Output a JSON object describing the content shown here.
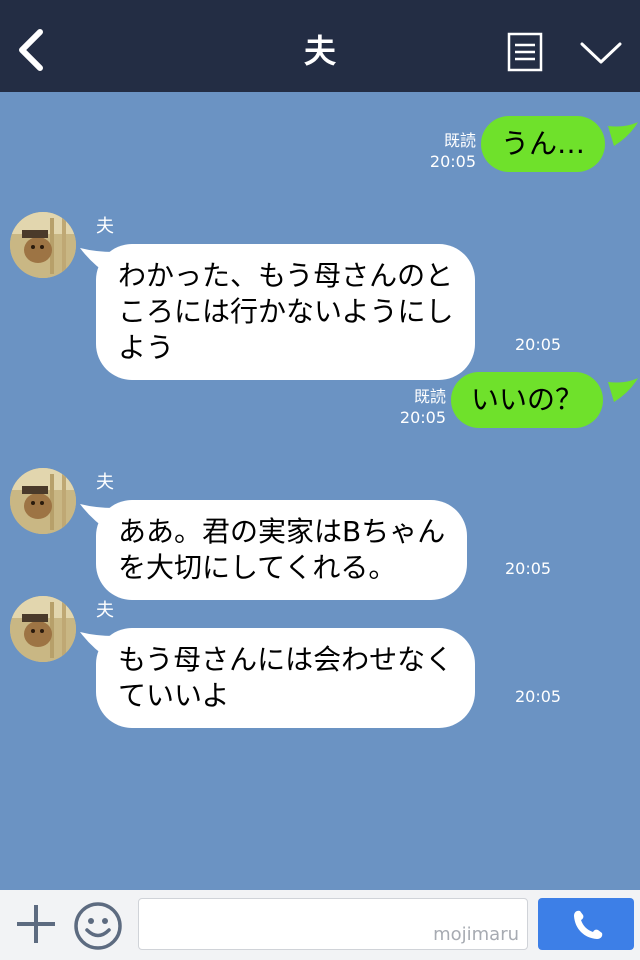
{
  "header": {
    "title": "夫"
  },
  "messages": [
    {
      "type": "sent",
      "text": "うん…",
      "read": "既読",
      "time": "20:05"
    },
    {
      "type": "received",
      "sender": "夫",
      "lines": [
        "わかった、もう母さんのと",
        "ころには行かないようにし",
        "よう"
      ],
      "time": "20:05"
    },
    {
      "type": "sent",
      "text": "いいの？",
      "read": "既読",
      "time": "20:05"
    },
    {
      "type": "received",
      "sender": "夫",
      "lines": [
        "ああ。君の実家はBちゃん",
        "を大切にしてくれる。"
      ],
      "time": "20:05"
    },
    {
      "type": "received",
      "sender": "夫",
      "lines": [
        "もう母さんには会わせなく",
        "ていいよ"
      ],
      "time": "20:05"
    }
  ],
  "footer": {
    "input_value": "",
    "watermark": "mojimaru"
  },
  "colors": {
    "header_bg": "#232d44",
    "chat_bg": "#6b93c3",
    "sent_bubble": "#6fe12b",
    "received_bubble": "#ffffff",
    "call_button": "#3d7fe7"
  },
  "icons": {
    "back": "chevron-left-icon",
    "menu": "menu-icon",
    "collapse": "chevron-down-icon",
    "add": "plus-icon",
    "sticker": "smiley-icon",
    "call": "phone-icon"
  }
}
